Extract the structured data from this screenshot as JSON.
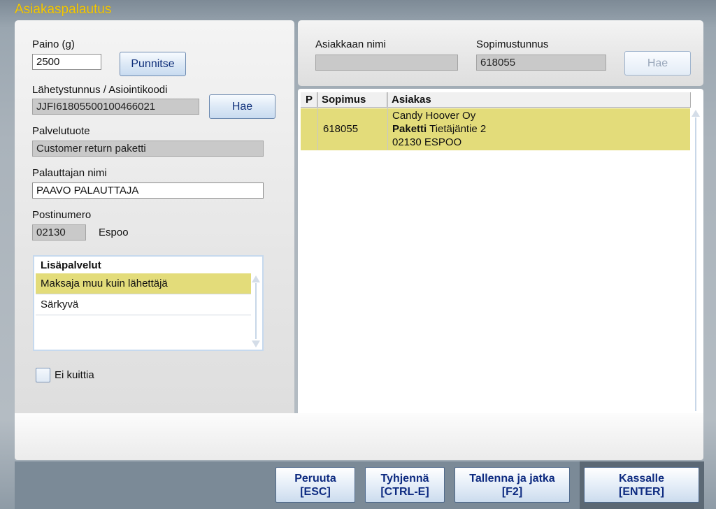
{
  "window": {
    "title": "Asiakaspalautus"
  },
  "left": {
    "weight_label": "Paino (g)",
    "weight_value": "2500",
    "weigh_button": "Punnitse",
    "tracking_label": "Lähetystunnus / Asiointikoodi",
    "tracking_value": "JJFI61805500100466021",
    "fetch_button": "Hae",
    "service_label": "Palvelutuote",
    "service_value": "Customer return paketti",
    "returner_label": "Palauttajan nimi",
    "returner_value": "PAAVO PALAUTTAJA",
    "postcode_label": "Postinumero",
    "postcode_value": "02130",
    "city": "Espoo",
    "extras": {
      "header": "Lisäpalvelut",
      "items": [
        "Maksaja muu kuin lähettäjä",
        "Särkyvä"
      ],
      "selected_index": 0
    },
    "no_receipt_label": "Ei kuittia",
    "no_receipt_checked": false
  },
  "search": {
    "customer_name_label": "Asiakkaan nimi",
    "customer_name_value": "",
    "contract_label": "Sopimustunnus",
    "contract_value": "618055",
    "fetch_button": "Hae",
    "fetch_enabled": false
  },
  "results": {
    "columns": [
      "P",
      "Sopimus",
      "Asiakas"
    ],
    "rows": [
      {
        "p": "",
        "contract": "618055",
        "customer_name": "Candy Hoover Oy",
        "product": "Paketti",
        "street": "Tietäjäntie 2",
        "postal": "02130 ESPOO"
      }
    ]
  },
  "footer": {
    "buttons": [
      {
        "label": "Peruuta",
        "shortcut": "[ESC]"
      },
      {
        "label": "Tyhjennä",
        "shortcut": "[CTRL-E]"
      },
      {
        "label": "Tallenna ja jatka",
        "shortcut": "[F2]"
      },
      {
        "label": "Kassalle",
        "shortcut": "[ENTER]"
      }
    ]
  },
  "colors": {
    "title": "#f5c800",
    "selection": "#e3dc7a",
    "button_text": "#0d2a80"
  }
}
